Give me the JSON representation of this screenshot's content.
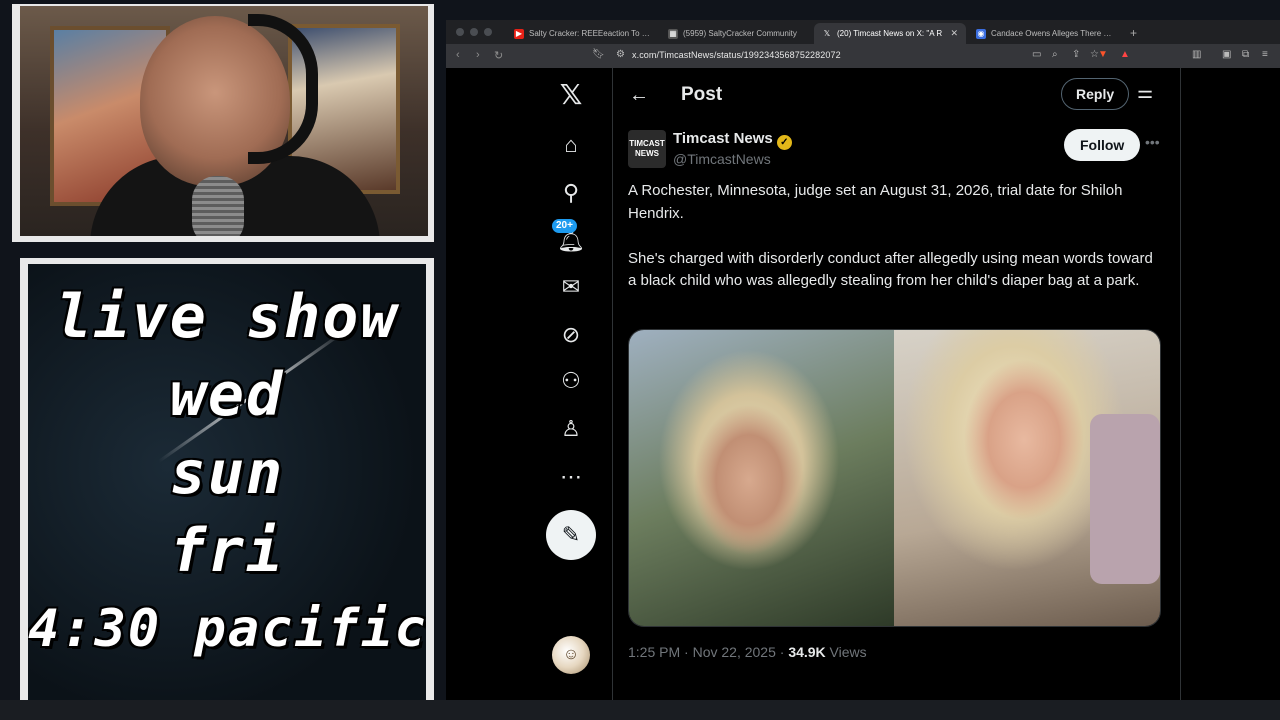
{
  "stream": {
    "schedule_lines": [
      "live show",
      "wed",
      "sun",
      "fri",
      "4:30 pacific"
    ]
  },
  "browser": {
    "tabs": [
      {
        "title": "Salty Cracker: REEEeaction To Co",
        "icon": "youtube-icon",
        "active": false
      },
      {
        "title": "(5959) SaltyCracker Community",
        "icon": "grid-icon",
        "active": false
      },
      {
        "title": "(20) Timcast News on X: \"A R",
        "icon": "x-icon",
        "active": true
      },
      {
        "title": "Candace Owens Alleges There is a",
        "icon": "globe-icon",
        "active": false
      }
    ],
    "url": "x.com/TimcastNews/status/1992343568752282072"
  },
  "x_nav": {
    "notifications_badge": "20+"
  },
  "post": {
    "header_title": "Post",
    "reply_label": "Reply",
    "account_logo_text": "TIMCAST NEWS",
    "author_name": "Timcast News",
    "author_handle": "@TimcastNews",
    "follow_label": "Follow",
    "paragraphs": [
      "A Rochester, Minnesota, judge set an August 31, 2026, trial date for Shiloh Hendrix.",
      "She's charged with disorderly conduct after allegedly using mean words toward a black child who was allegedly stealing from her child's diaper bag at a park."
    ],
    "timestamp": "1:25 PM · Nov 22, 2025 · ",
    "views_count": "34.9K",
    "views_label": " Views"
  },
  "colors": {
    "accent_blue": "#1d9bf0",
    "verified_gold": "#e2b719",
    "x_background": "#000000"
  }
}
